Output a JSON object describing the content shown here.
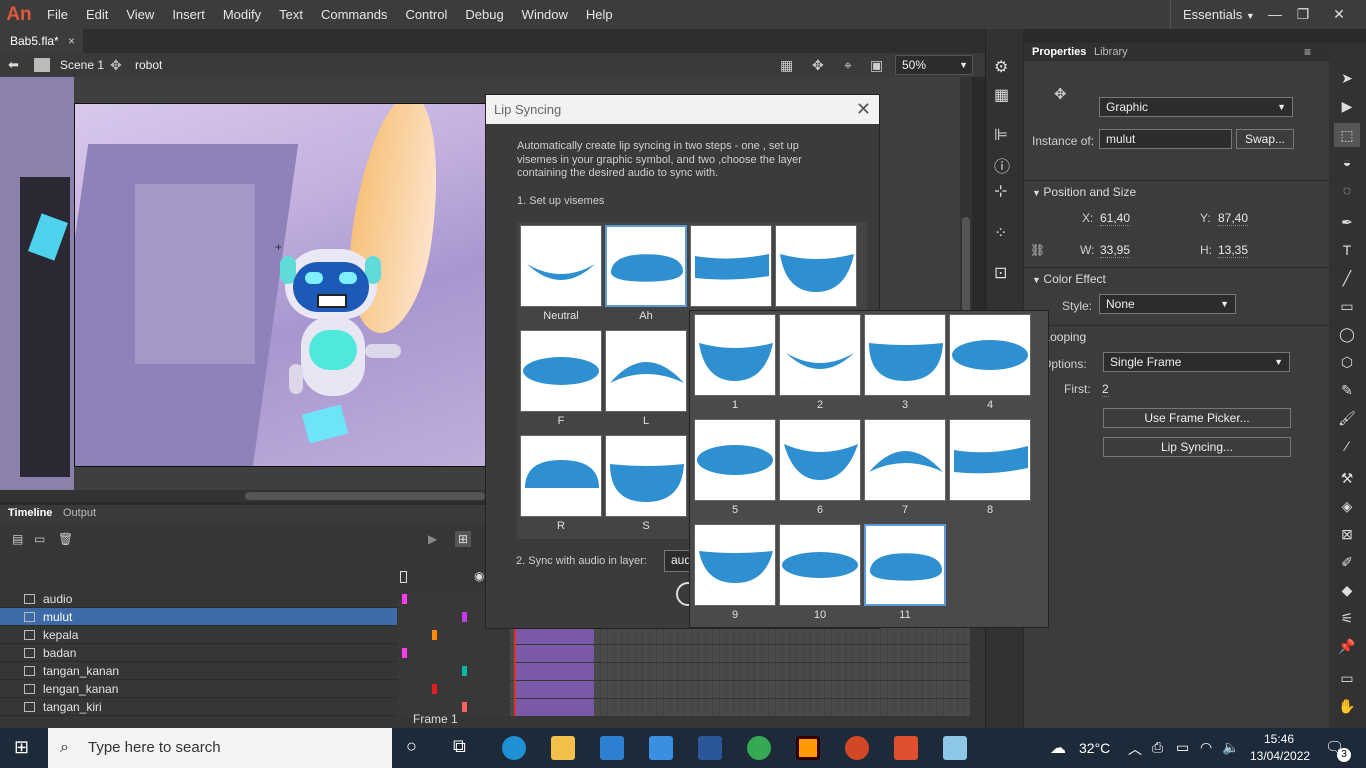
{
  "app": {
    "logo": "An"
  },
  "menu": [
    "File",
    "Edit",
    "View",
    "Insert",
    "Modify",
    "Text",
    "Commands",
    "Control",
    "Debug",
    "Window",
    "Help"
  ],
  "workspace": "Essentials",
  "document": {
    "tab": "Bab5.fla*",
    "close": "×",
    "scene": "Scene 1",
    "symbol": "robot",
    "zoom": "50%"
  },
  "timeline": {
    "tabs": [
      "Timeline",
      "Output"
    ],
    "frame_label": "Frame",
    "frame_value": "1",
    "layers": [
      "audio",
      "mulut",
      "kepala",
      "badan",
      "tangan_kanan",
      "lengan_kanan",
      "tangan_kiri"
    ]
  },
  "properties": {
    "tabs": [
      "Properties",
      "Library"
    ],
    "type": "Graphic",
    "instance_label": "Instance of:",
    "instance_value": "mulut",
    "swap": "Swap...",
    "pos_size": "Position and Size",
    "x_label": "X:",
    "x": "61,40",
    "y_label": "Y:",
    "y": "87,40",
    "w_label": "W:",
    "w": "33,95",
    "h_label": "H:",
    "h": "13,35",
    "color_effect": "Color Effect",
    "style_label": "Style:",
    "style": "None",
    "looping": "Looping",
    "options_label": "Options:",
    "options": "Single Frame",
    "first_label": "First:",
    "first": "2",
    "frame_picker": "Use Frame Picker...",
    "lip_sync": "Lip Syncing..."
  },
  "dialog": {
    "title": "Lip Syncing",
    "close": "✕",
    "intro": "Automatically create lip syncing in two steps - one , set up visemes in your graphic symbol, and two ,choose the layer containing the desired audio to sync with.",
    "step1": "1. Set up visemes",
    "step2": "2. Sync with audio in layer:",
    "audio_value": "aud",
    "visemes": [
      "Neutral",
      "Ah",
      "F",
      "L",
      "R",
      "S"
    ]
  },
  "popup": {
    "frames": [
      "1",
      "2",
      "3",
      "4",
      "5",
      "6",
      "7",
      "8",
      "9",
      "10",
      "11"
    ],
    "selected": "11"
  },
  "taskbar": {
    "search": "Type here to search",
    "temp": "32°C",
    "time": "15:46",
    "date": "13/04/2022",
    "notifications": "3"
  },
  "colors": {
    "accent": "#3e6aa8",
    "mouth": "#2e8fd1",
    "animate": "#e05a3a"
  }
}
